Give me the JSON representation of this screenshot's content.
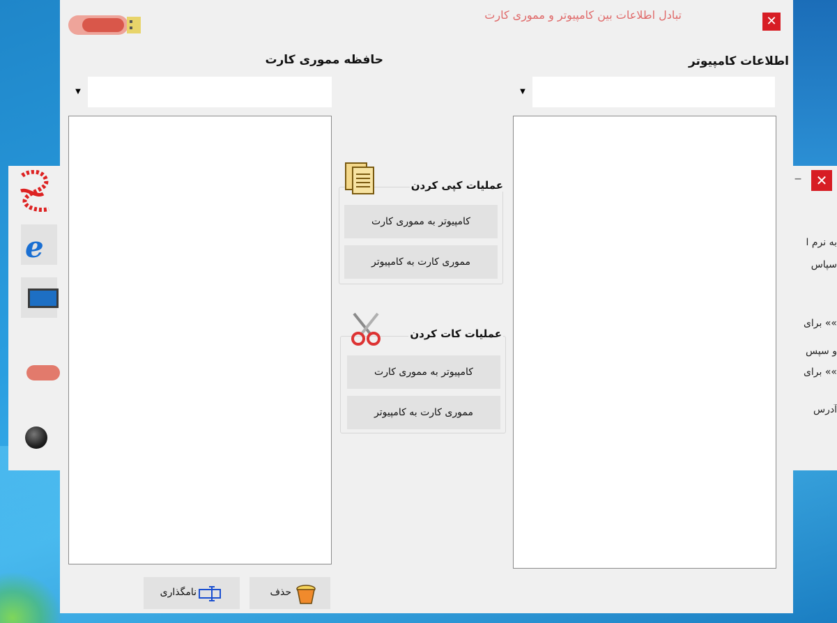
{
  "desktop": {
    "bg_window": {
      "lines": [
        "به نرم ا",
        "سپاس",
        "»» برای",
        "و سپس",
        "»» برای",
        "آدرس"
      ],
      "minimize_glyph": "–",
      "close_glyph": "✕"
    }
  },
  "dialog": {
    "title": "تبادل اطلاعات بین کامپیوتر و مموری کارت",
    "close_glyph": "✕",
    "memory_panel": {
      "title": "حافظه مموری کارت",
      "drive_value": "",
      "items": []
    },
    "computer_panel": {
      "title": "اطلاعات کامپیوتر",
      "drive_value": "",
      "items": []
    },
    "copy_group": {
      "title": "عملیات کپی کردن",
      "btn_pc_to_card": "کامپیوتر به مموری کارت",
      "btn_card_to_pc": "مموری کارت به کامپیوتر"
    },
    "cut_group": {
      "title": "عملیات کات کردن",
      "btn_pc_to_card": "کامپیوتر به مموری کارت",
      "btn_card_to_pc": "مموری کارت به کامپیوتر"
    },
    "bottom": {
      "rename_label": "نامگذاری",
      "delete_label": "حذف"
    }
  }
}
